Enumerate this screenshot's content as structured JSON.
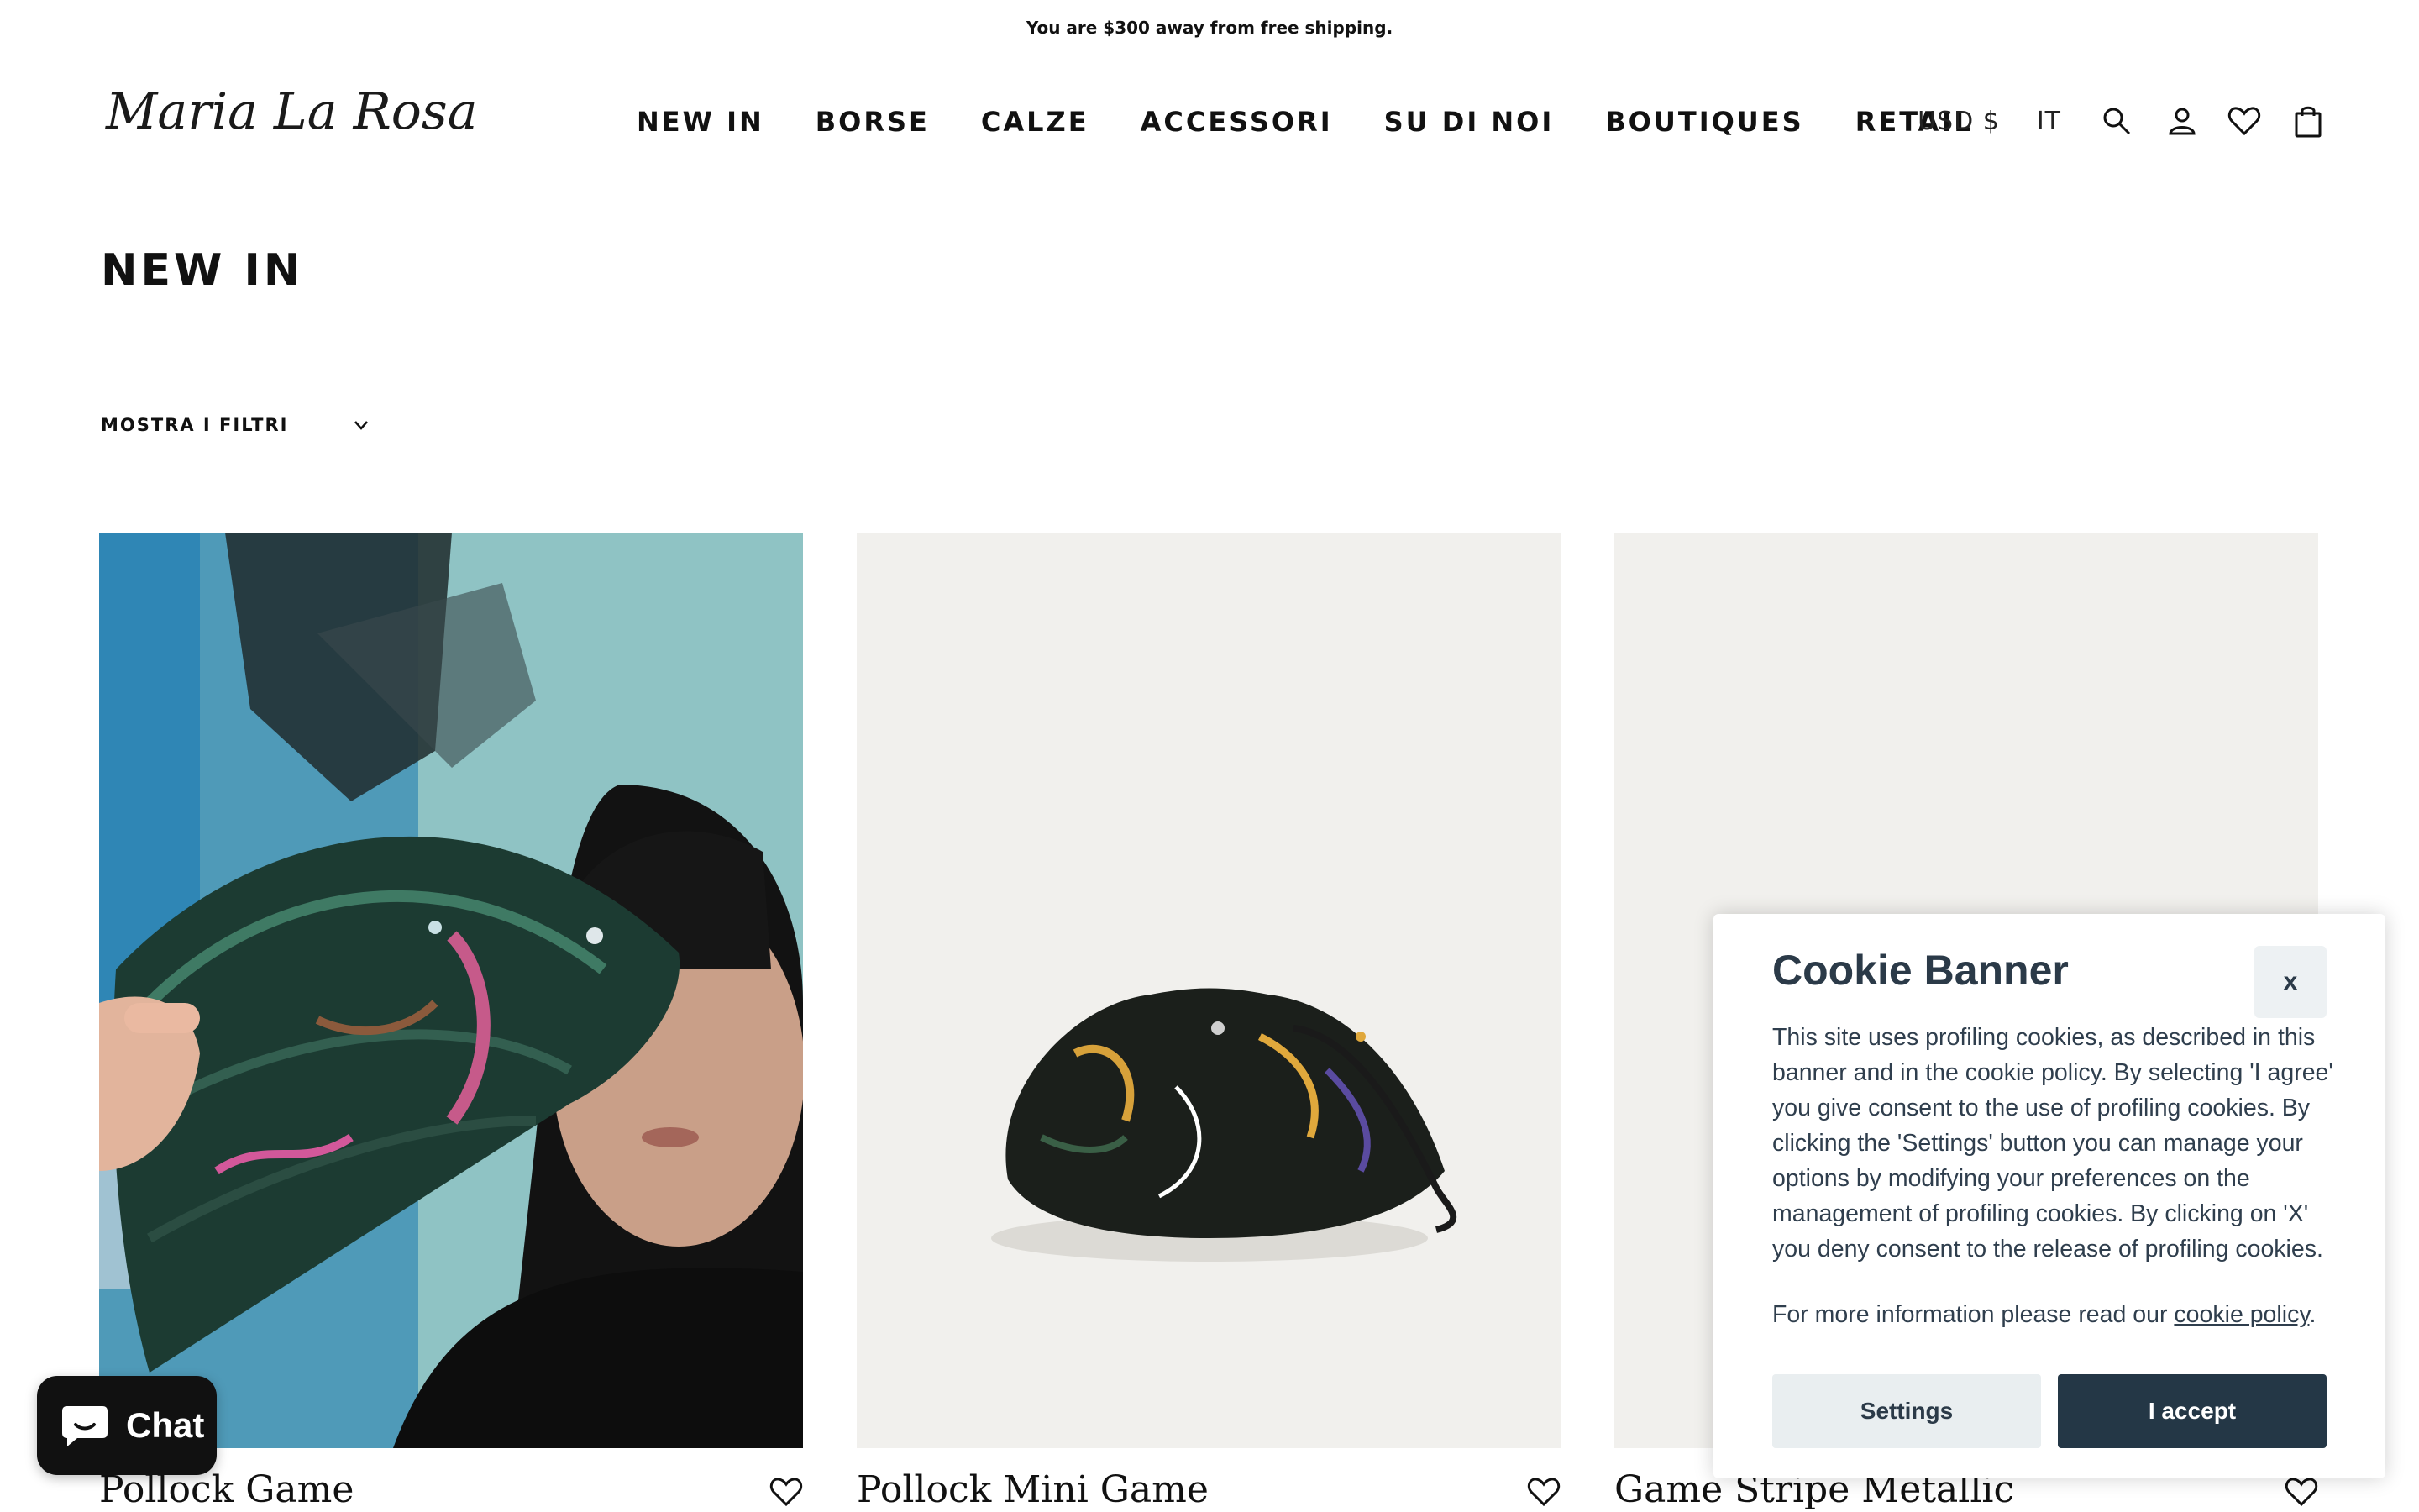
{
  "announcement": "You are $300 away from free shipping.",
  "brand": {
    "logo_text": "Maria La Rosa"
  },
  "nav": {
    "items": [
      {
        "label": "NEW IN"
      },
      {
        "label": "BORSE"
      },
      {
        "label": "CALZE"
      },
      {
        "label": "ACCESSORI"
      },
      {
        "label": "SU DI NOI"
      },
      {
        "label": "BOUTIQUES"
      },
      {
        "label": "RETAIL"
      }
    ]
  },
  "utility": {
    "currency": "USD $",
    "language": "IT",
    "icons": [
      "search-icon",
      "account-icon",
      "heart-icon",
      "bag-icon"
    ]
  },
  "page": {
    "title": "NEW IN"
  },
  "filters": {
    "toggle_label": "MOSTRA I FILTRI",
    "icon": "chevron-down-icon"
  },
  "products": [
    {
      "name": "Pollock Game",
      "image": "model holding woven green clutch"
    },
    {
      "name": "Pollock Mini Game",
      "image": "black woven pouch with chain"
    },
    {
      "name": "Game Stripe Metallic",
      "image": "product image"
    }
  ],
  "chat": {
    "label": "Chat",
    "icon": "chat-bubble-icon"
  },
  "cookie_banner": {
    "title": "Cookie Banner",
    "close_label": "x",
    "body": "This site uses profiling cookies, as described in this banner and in the cookie policy. By selecting 'I agree' you give consent to the use of profiling cookies. By clicking the 'Settings' button you can manage your options by modifying your preferences on the management of profiling cookies. By clicking on 'X' you deny consent to the release of profiling cookies.",
    "more_prefix": "For more information please read our ",
    "more_link": "cookie policy",
    "more_suffix": ".",
    "settings_label": "Settings",
    "accept_label": "I accept"
  },
  "colors": {
    "text": "#111111",
    "cookie_dark": "#243746",
    "cookie_light": "#e9eef0",
    "product_bg": "#f1f0ed"
  }
}
